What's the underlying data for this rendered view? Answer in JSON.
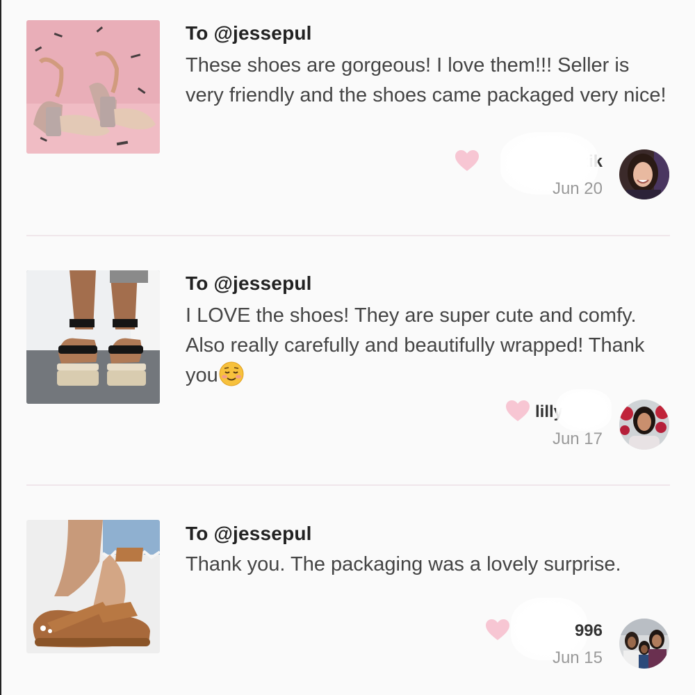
{
  "reviews": [
    {
      "to": "To @jessepul",
      "text": "These shoes are gorgeous! I love them!!! Seller is very friendly and the shoes came packaged very nice!",
      "username": "as        zik",
      "date": "Jun 20",
      "thumb_icon": "glitter-block-heel-sandals-photo",
      "avatar_icon": "reviewer-avatar-photo"
    },
    {
      "to": "To @jessepul",
      "text": "I LOVE the shoes! They are super cute and comfy. Also really carefully and beautifully wrapped! Thank you",
      "emoji": "smiling-face-emoji",
      "username": "lilly",
      "date": "Jun 17",
      "thumb_icon": "black-espadrille-sandals-photo",
      "avatar_icon": "reviewer-avatar-photo"
    },
    {
      "to": "To @jessepul",
      "text": "Thank you. The packaging was a lovely surprise.",
      "username": "996",
      "date": "Jun 15",
      "thumb_icon": "tan-strap-sandals-photo",
      "avatar_icon": "reviewer-avatar-photo"
    }
  ],
  "colors": {
    "heart": "#f7c6d3",
    "divider": "#f0e6ea",
    "background": "#fafafa"
  }
}
